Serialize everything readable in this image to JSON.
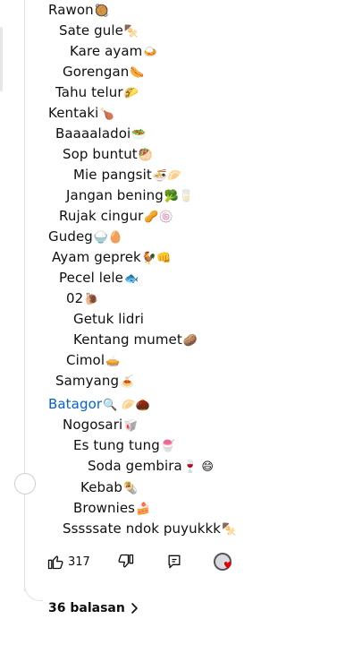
{
  "comment": {
    "lines": [
      {
        "text": "Rawon",
        "emoji": "🥘"
      },
      {
        "text": "Sate gule",
        "emoji": "🍢"
      },
      {
        "text": "Kare ayam",
        "emoji": "🍛"
      },
      {
        "text": "Gorengan",
        "emoji": "🌭"
      },
      {
        "text": "Tahu telur",
        "emoji": "🌮"
      },
      {
        "text": "Kentaki",
        "emoji": "🍗"
      },
      {
        "text": "Baaaaladoi",
        "emoji": "🥗"
      },
      {
        "text": "Sop buntut",
        "emoji": "🥙"
      },
      {
        "text": "Mie pangsit",
        "emoji": "🍜🥟"
      },
      {
        "text": "Jangan bening",
        "emoji": "🥦🥛"
      },
      {
        "text": "Rujak cingur",
        "emoji": "🥜🍥"
      },
      {
        "text": "Gudeg",
        "emoji": "🍚🥚"
      },
      {
        "text": "Ayam geprek",
        "emoji": "🐓👊"
      },
      {
        "text": "Pecel lele",
        "emoji": "🐟"
      },
      {
        "text": "02",
        "emoji": "🐌"
      },
      {
        "text": "Getuk lidri",
        "emoji": ""
      },
      {
        "text": "Kentang mumet",
        "emoji": "🥔"
      },
      {
        "text": "Cimol",
        "emoji": "🥧"
      },
      {
        "text": "Samyang",
        "emoji": "🍝"
      },
      {
        "text": "Batagor",
        "emoji": "🔍 🥟🌰"
      },
      {
        "text": "Nogosari",
        "emoji": "🥡"
      },
      {
        "text": "Es tung tung",
        "emoji": "🍧"
      },
      {
        "text": "Soda gembira",
        "emoji": "🍷 😄"
      },
      {
        "text": "Kebab",
        "emoji": "🌯"
      },
      {
        "text": "Brownies",
        "emoji": "🍰"
      },
      {
        "text": "Sssssate ndok puyukkk",
        "emoji": "🍢"
      }
    ]
  },
  "actions": {
    "like_count": "317",
    "icons": {
      "like": "thumbs-up-icon",
      "dislike": "thumbs-down-icon",
      "reply": "reply-comment-icon",
      "creator_heart": "creator-heart-icon"
    }
  },
  "replies": {
    "label": "36 balasan",
    "icon": "chevron-right-icon"
  },
  "colors": {
    "link": "#065fd4",
    "heart": "#e00000",
    "text": "#0f0f0f"
  }
}
